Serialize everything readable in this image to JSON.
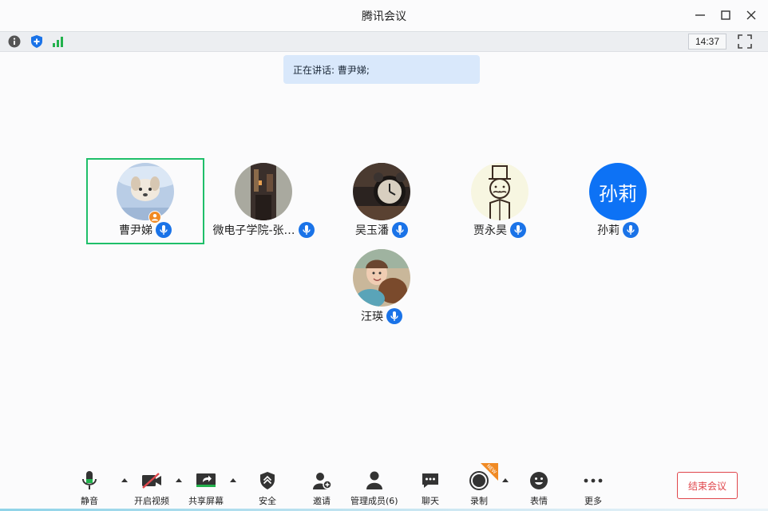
{
  "window": {
    "title": "腾讯会议"
  },
  "infobar": {
    "time": "14:37"
  },
  "banner": {
    "text": "正在讲话: 曹尹娣;"
  },
  "participants": [
    {
      "name": "曹尹娣",
      "avatar": "photo-dog-sky",
      "active": true,
      "host": true
    },
    {
      "name": "微电子学院-张…",
      "avatar": "photo-street-night"
    },
    {
      "name": "吴玉潘",
      "avatar": "photo-alarm-clock"
    },
    {
      "name": "贾永昊",
      "avatar": "cartoon-top-hat-man"
    },
    {
      "name": "孙莉",
      "avatar": "text-avatar",
      "avatar_text": "孙莉",
      "avatar_color": "#0d72f5"
    },
    {
      "name": "汪瑛",
      "avatar": "photo-child-dog"
    }
  ],
  "toolbar": {
    "mute": "静音",
    "video": "开启视频",
    "share": "共享屏幕",
    "security": "安全",
    "invite": "邀请",
    "members": "管理成员(6)",
    "chat": "聊天",
    "record": "录制",
    "record_badge": "NEW",
    "emoji": "表情",
    "more": "更多",
    "end": "结束会议"
  },
  "colors": {
    "accent": "#1a73e8",
    "active_border": "#1fbf6a",
    "end": "#e0474c",
    "banner": "#d9e8fb"
  }
}
